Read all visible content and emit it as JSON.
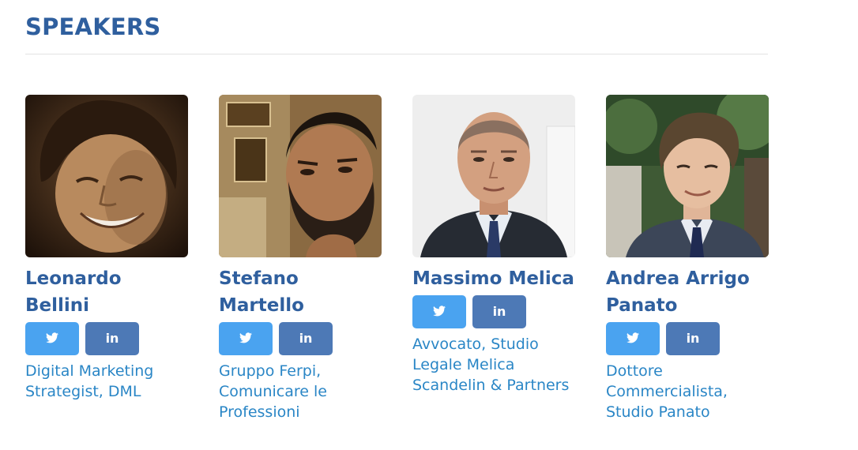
{
  "section": {
    "title": "SPEAKERS"
  },
  "speakers": [
    {
      "name": "Leonardo Bellini",
      "role": "Digital Marketing Strategist, DML",
      "photo": "speaker-photo-leonardo-bellini",
      "twitter_icon": "twitter-icon",
      "linkedin_label": "in"
    },
    {
      "name": "Stefano Martello",
      "role": "Gruppo Ferpi, Comunicare le Professioni",
      "photo": "speaker-photo-stefano-martello",
      "twitter_icon": "twitter-icon",
      "linkedin_label": "in"
    },
    {
      "name": "Massimo Melica",
      "role": "Avvocato, Studio Legale Melica Scandelin & Partners",
      "photo": "speaker-photo-massimo-melica",
      "twitter_icon": "twitter-icon",
      "linkedin_label": "in"
    },
    {
      "name": "Andrea Arrigo Panato",
      "role": "Dottore Commercialista, Studio Panato",
      "photo": "speaker-photo-andrea-arrigo-panato",
      "twitter_icon": "twitter-icon",
      "linkedin_label": "in"
    }
  ],
  "colors": {
    "heading": "#2f5f9e",
    "role_text": "#2a86c6",
    "twitter_button": "#4aa3f0",
    "linkedin_button": "#4d79b6",
    "divider": "#e3e3e3"
  }
}
